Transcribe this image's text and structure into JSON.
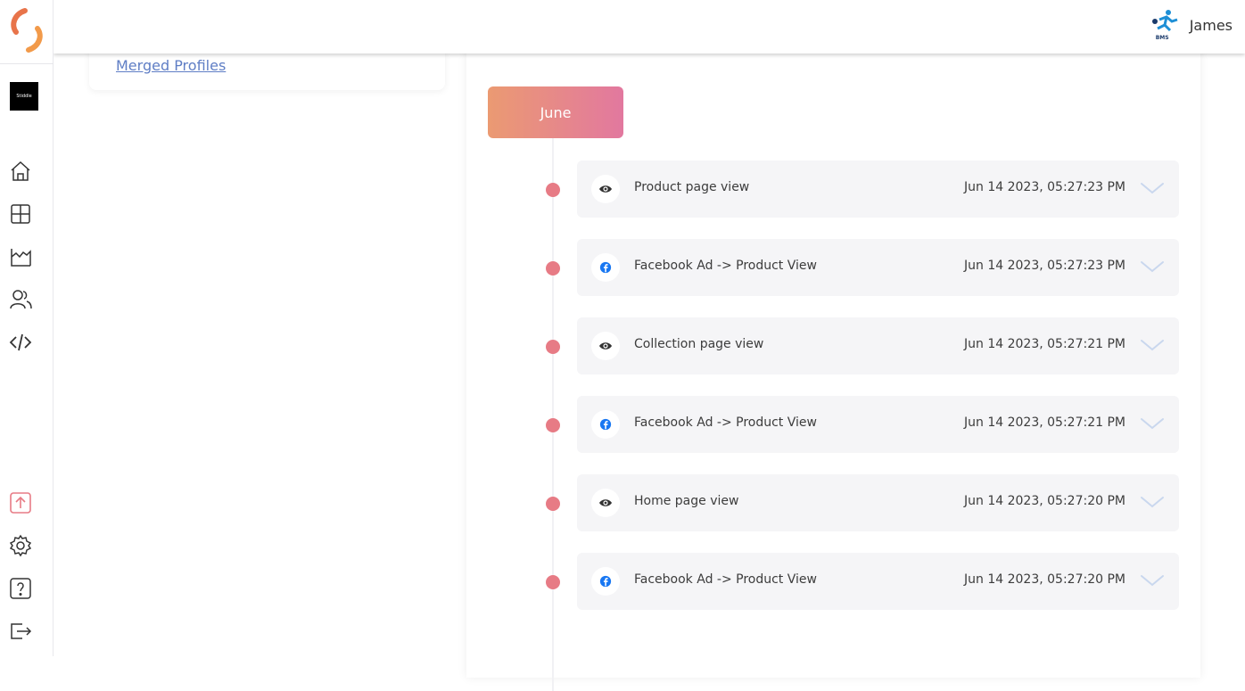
{
  "user": {
    "name": "James",
    "org_logo_text": "BMS"
  },
  "workspace": {
    "label": "Stiddle"
  },
  "sidebar": {
    "top_items": [
      {
        "name": "home",
        "icon": "home-icon"
      },
      {
        "name": "dashboard",
        "icon": "grid-icon"
      },
      {
        "name": "analytics",
        "icon": "area-chart-icon"
      },
      {
        "name": "audience",
        "icon": "users-icon"
      },
      {
        "name": "developer",
        "icon": "code-icon"
      }
    ],
    "bottom_items": [
      {
        "name": "upgrade",
        "icon": "upload-icon"
      },
      {
        "name": "settings",
        "icon": "gear-icon"
      },
      {
        "name": "help",
        "icon": "help-icon"
      },
      {
        "name": "logout",
        "icon": "logout-icon"
      }
    ]
  },
  "profile_card": {
    "merged_profiles_link": "Merged Profiles"
  },
  "timeline": {
    "month": "June",
    "events": [
      {
        "icon": "eye-icon",
        "title": "Product page view",
        "time": "Jun 14 2023, 05:27:23 PM"
      },
      {
        "icon": "facebook-icon",
        "title": "Facebook Ad -> Product View",
        "time": "Jun 14 2023, 05:27:23 PM"
      },
      {
        "icon": "eye-icon",
        "title": "Collection page view",
        "time": "Jun 14 2023, 05:27:21 PM"
      },
      {
        "icon": "facebook-icon",
        "title": "Facebook Ad -> Product View",
        "time": "Jun 14 2023, 05:27:21 PM"
      },
      {
        "icon": "eye-icon",
        "title": "Home page view",
        "time": "Jun 14 2023, 05:27:20 PM"
      },
      {
        "icon": "facebook-icon",
        "title": "Facebook Ad -> Product View",
        "time": "Jun 14 2023, 05:27:20 PM"
      }
    ]
  },
  "colors": {
    "accent": "#e77b85",
    "gradient_start": "#eb9a72",
    "gradient_end": "#e2789f",
    "link": "#5f7ec5",
    "facebook": "#1877f2"
  }
}
